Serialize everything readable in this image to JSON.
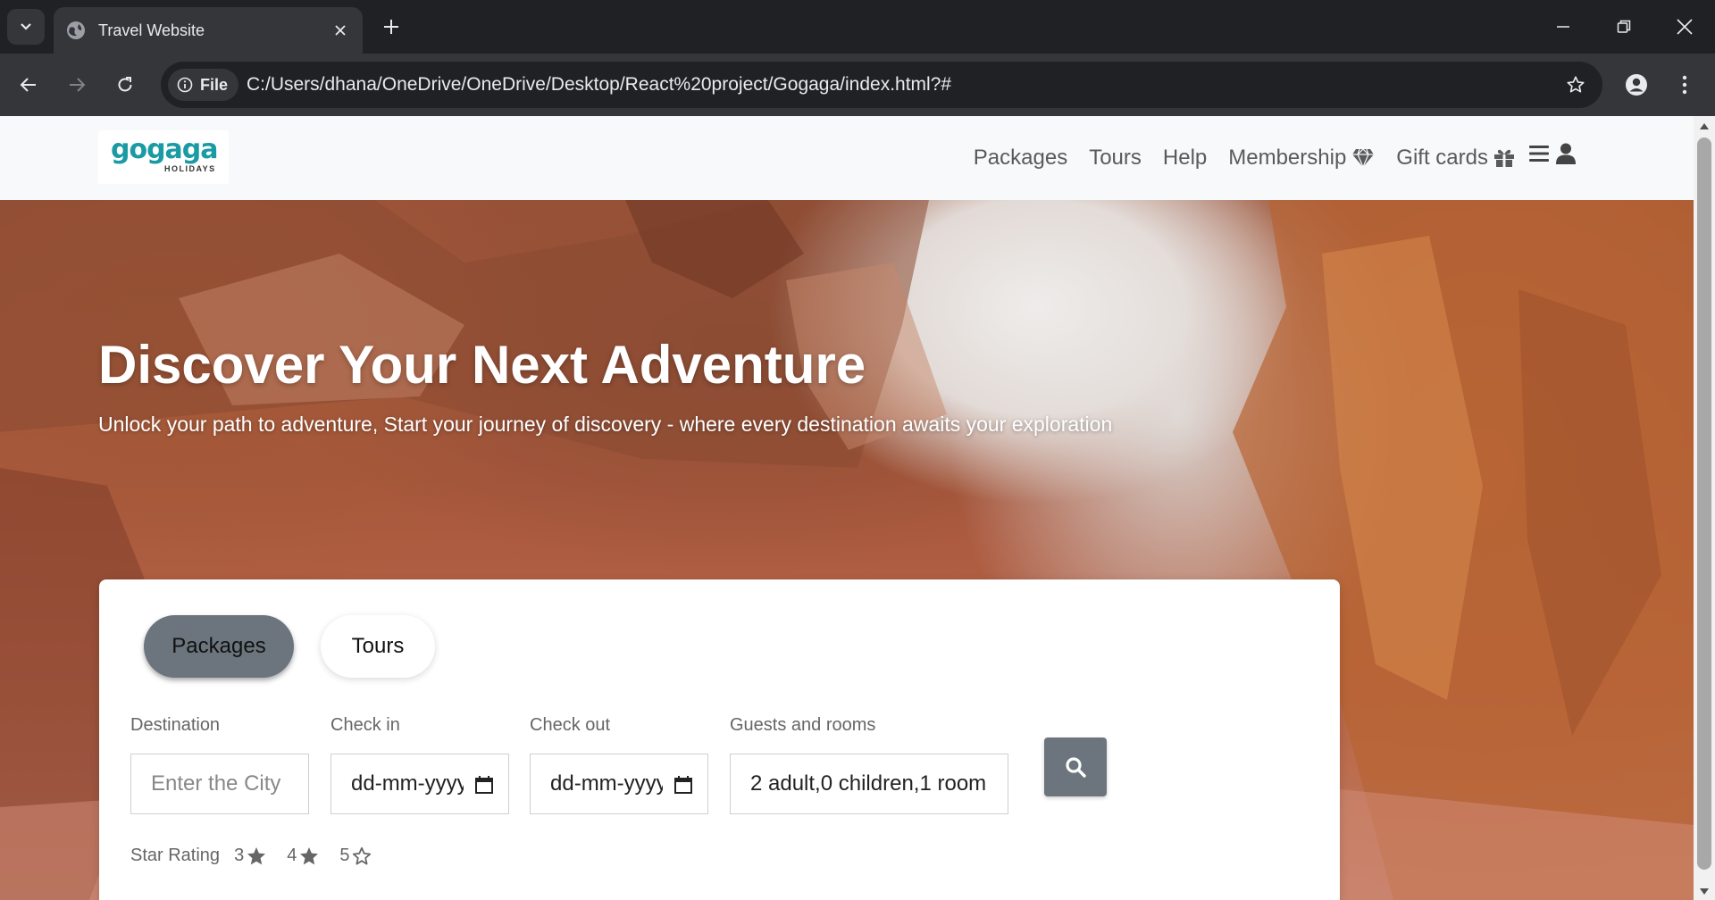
{
  "browser": {
    "tab_title": "Travel Website",
    "site_info_label": "File",
    "url": "C:/Users/dhana/OneDrive/OneDrive/Desktop/React%20project/Gogaga/index.html?#"
  },
  "site": {
    "logo_text": "gogaga",
    "logo_subtext": "HOLIDAYS",
    "nav": [
      {
        "label": "Packages",
        "icon": null
      },
      {
        "label": "Tours",
        "icon": null
      },
      {
        "label": "Help",
        "icon": null
      },
      {
        "label": "Membership",
        "icon": "gem-icon"
      },
      {
        "label": "Gift cards",
        "icon": "gift-icon"
      }
    ],
    "nav_extra_icons": [
      "hamburger-menu-icon",
      "user-icon"
    ]
  },
  "hero": {
    "title": "Discover Your Next Adventure",
    "subtitle": "Unlock your path to adventure, Start your journey of discovery - where every destination awaits your exploration"
  },
  "search": {
    "tabs": [
      {
        "label": "Packages",
        "active": true
      },
      {
        "label": "Tours",
        "active": false
      }
    ],
    "fields": {
      "destination": {
        "label": "Destination",
        "placeholder": "Enter the City"
      },
      "check_in": {
        "label": "Check in",
        "value": "dd-mm-yyyy"
      },
      "check_out": {
        "label": "Check out",
        "value": "dd-mm-yyyy"
      },
      "guests": {
        "label": "Guests and rooms",
        "value": "2 adult,0 children,1 room"
      }
    },
    "rating": {
      "label": "Star Rating",
      "options": [
        {
          "value": "3",
          "icon": "star-filled-icon"
        },
        {
          "value": "4",
          "icon": "star-filled-icon"
        },
        {
          "value": "5",
          "icon": "star-outline-icon"
        }
      ]
    }
  },
  "colors": {
    "accent_gray": "#6c757d",
    "brand_teal": "#1a9aa3",
    "chrome_dark": "#202124"
  }
}
